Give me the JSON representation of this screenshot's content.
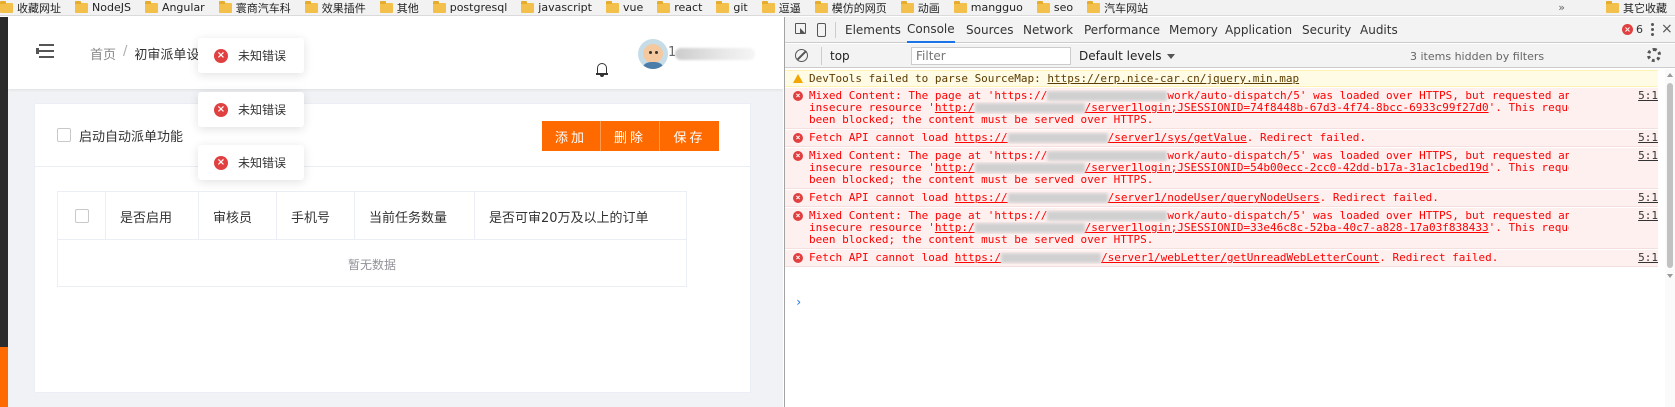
{
  "bookmarks": {
    "items": [
      "收藏网址",
      "NodeJS",
      "Angular",
      "寰商汽车科",
      "效果插件",
      "其他",
      "postgresql",
      "javascript",
      "vue",
      "react",
      "git",
      "逗逼",
      "模仿的网页",
      "动画",
      "mangguo",
      "seo",
      "汽车网站"
    ],
    "more": "»",
    "other": "其它收藏"
  },
  "app": {
    "breadcrumb": {
      "home": "首页",
      "separator": "/",
      "current": "初审派单设置"
    },
    "auto_dispatch_label": "启动自动派单功能",
    "buttons": {
      "add": "添加",
      "delete": "删除",
      "save": "保存"
    },
    "table": {
      "headers": [
        "是否启用",
        "审核员",
        "手机号",
        "当前任务数量",
        "是否可审20万及以上的订单"
      ],
      "empty_text": "暂无数据"
    },
    "toasts": [
      "未知错误",
      "未知错误",
      "未知错误"
    ],
    "username_visible": "1"
  },
  "devtools": {
    "tabs": [
      "Elements",
      "Console",
      "Sources",
      "Network",
      "Performance",
      "Memory",
      "Application",
      "Security",
      "Audits"
    ],
    "active_tab": "Console",
    "error_count": "6",
    "close": "×",
    "context": "top",
    "filter_placeholder": "Filter",
    "levels": "Default levels",
    "hidden_items": "3 items hidden by filters",
    "messages": [
      {
        "type": "warn",
        "lines": [
          "DevTools failed to parse SourceMap: ",
          "https://erp.nice-car.cn/jquery.min.map"
        ],
        "src": ""
      },
      {
        "type": "error",
        "lines": [
          "Mixed Content: The page at 'https://",
          "work/auto-dispatch/5' was loaded over HTTPS, but requested an",
          "insecure resource '",
          "http:/",
          "/server1login;JSESSIONID=74f8448b-67d3-4f74-8bcc-6933c99f27d0",
          "'. This request has",
          "been blocked; the content must be served over HTTPS."
        ],
        "src": "5:1"
      },
      {
        "type": "error",
        "lines": [
          "Fetch API cannot load ",
          "https://",
          "/server1/sys/getValue",
          ". Redirect failed."
        ],
        "src": "5:1"
      },
      {
        "type": "error",
        "lines": [
          "Mixed Content: The page at 'https://",
          "work/auto-dispatch/5' was loaded over HTTPS, but requested an",
          "insecure resource '",
          "http:/",
          "/server1login;JSESSIONID=54b00ecc-2cc0-42dd-b17a-31ac1cbed19d",
          "'. This request has",
          "been blocked; the content must be served over HTTPS."
        ],
        "src": "5:1"
      },
      {
        "type": "error",
        "lines": [
          "Fetch API cannot load ",
          "https://",
          "/server1/nodeUser/queryNodeUsers",
          ". Redirect failed."
        ],
        "src": "5:1"
      },
      {
        "type": "error",
        "lines": [
          "Mixed Content: The page at 'https://",
          "work/auto-dispatch/5' was loaded over HTTPS, but requested an",
          "insecure resource '",
          "http:/",
          "/server1login;JSESSIONID=33e46c8c-52ba-40c7-a828-17a03f838433",
          "'. This request has",
          "been blocked; the content must be served over HTTPS."
        ],
        "src": "5:1"
      },
      {
        "type": "error",
        "lines": [
          "Fetch API cannot load ",
          "https:/",
          "/server1/webLetter/getUnreadWebLetterCount",
          ". Redirect failed."
        ],
        "src": "5:1"
      }
    ],
    "prompt": "›"
  },
  "colors": {
    "accent": "#ff6a00",
    "error": "#ff0000",
    "devtools_active": "#1a73e8"
  }
}
